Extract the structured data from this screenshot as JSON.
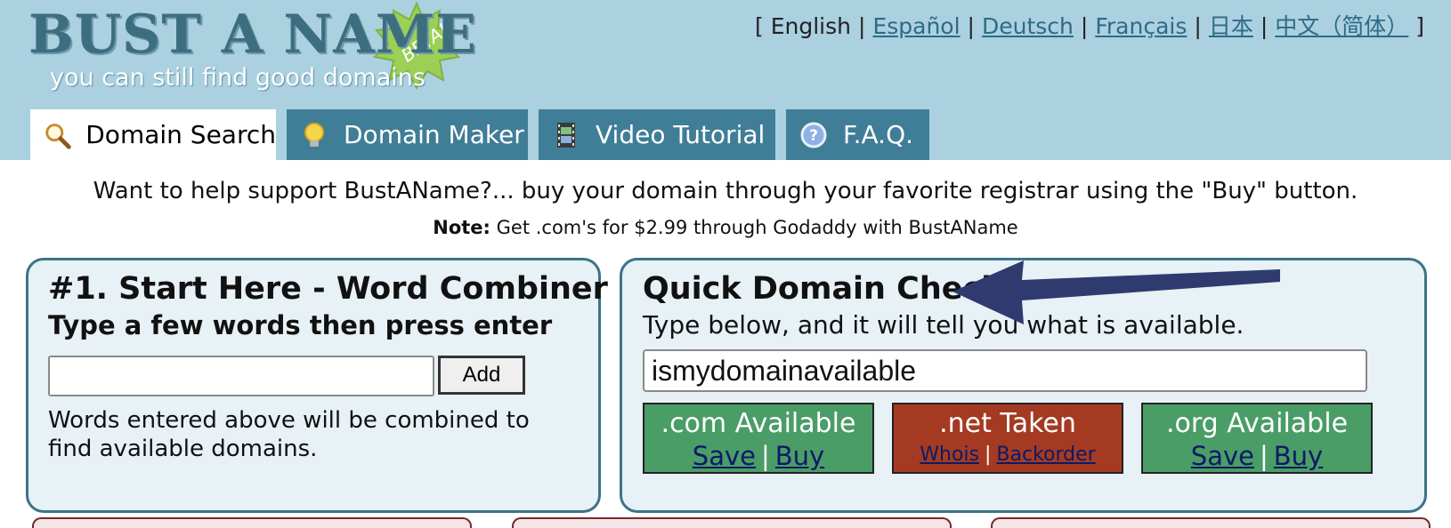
{
  "logo": {
    "title": "BUST A NAME",
    "badge": "BETA!",
    "tagline": "you can still find good domains"
  },
  "languages": {
    "open_bracket": "[",
    "close_bracket": "]",
    "current": "English",
    "links": [
      "Español",
      "Deutsch",
      "Français",
      "日本",
      "中文（简体）"
    ]
  },
  "tabs": [
    {
      "label": "Domain Search",
      "icon": "magnifier-icon"
    },
    {
      "label": "Domain Maker",
      "icon": "lightbulb-icon"
    },
    {
      "label": "Video Tutorial",
      "icon": "film-icon"
    },
    {
      "label": "F.A.Q.",
      "icon": "question-icon"
    }
  ],
  "notice": {
    "text": "Want to help support BustAName?... buy your domain through your favorite registrar using the \"Buy\" button.",
    "note_label": "Note:",
    "note_text": "Get .com's for $2.99 through Godaddy with BustAName"
  },
  "word_combiner": {
    "title": "#1. Start Here - Word Combiner",
    "subtitle": "Type a few words then press enter",
    "input_value": "",
    "add_label": "Add",
    "description": "Words entered above will be combined to find available domains."
  },
  "quick_check": {
    "title": "Quick Domain Check",
    "subtitle": "Type below, and it will tell you what is available.",
    "input_value": "ismydomainavailable",
    "results": [
      {
        "title": ".com Available",
        "status": "available",
        "links": [
          "Save",
          "Buy"
        ]
      },
      {
        "title": ".net Taken",
        "status": "taken",
        "links": [
          "Whois",
          "Backorder"
        ]
      },
      {
        "title": ".org Available",
        "status": "available",
        "links": [
          "Save",
          "Buy"
        ]
      }
    ]
  },
  "colors": {
    "header_bg": "#abd0e0",
    "tab_bg": "#3f7e96",
    "available": "#4a9d66",
    "taken": "#a43a22",
    "arrow": "#2f3a6e"
  }
}
